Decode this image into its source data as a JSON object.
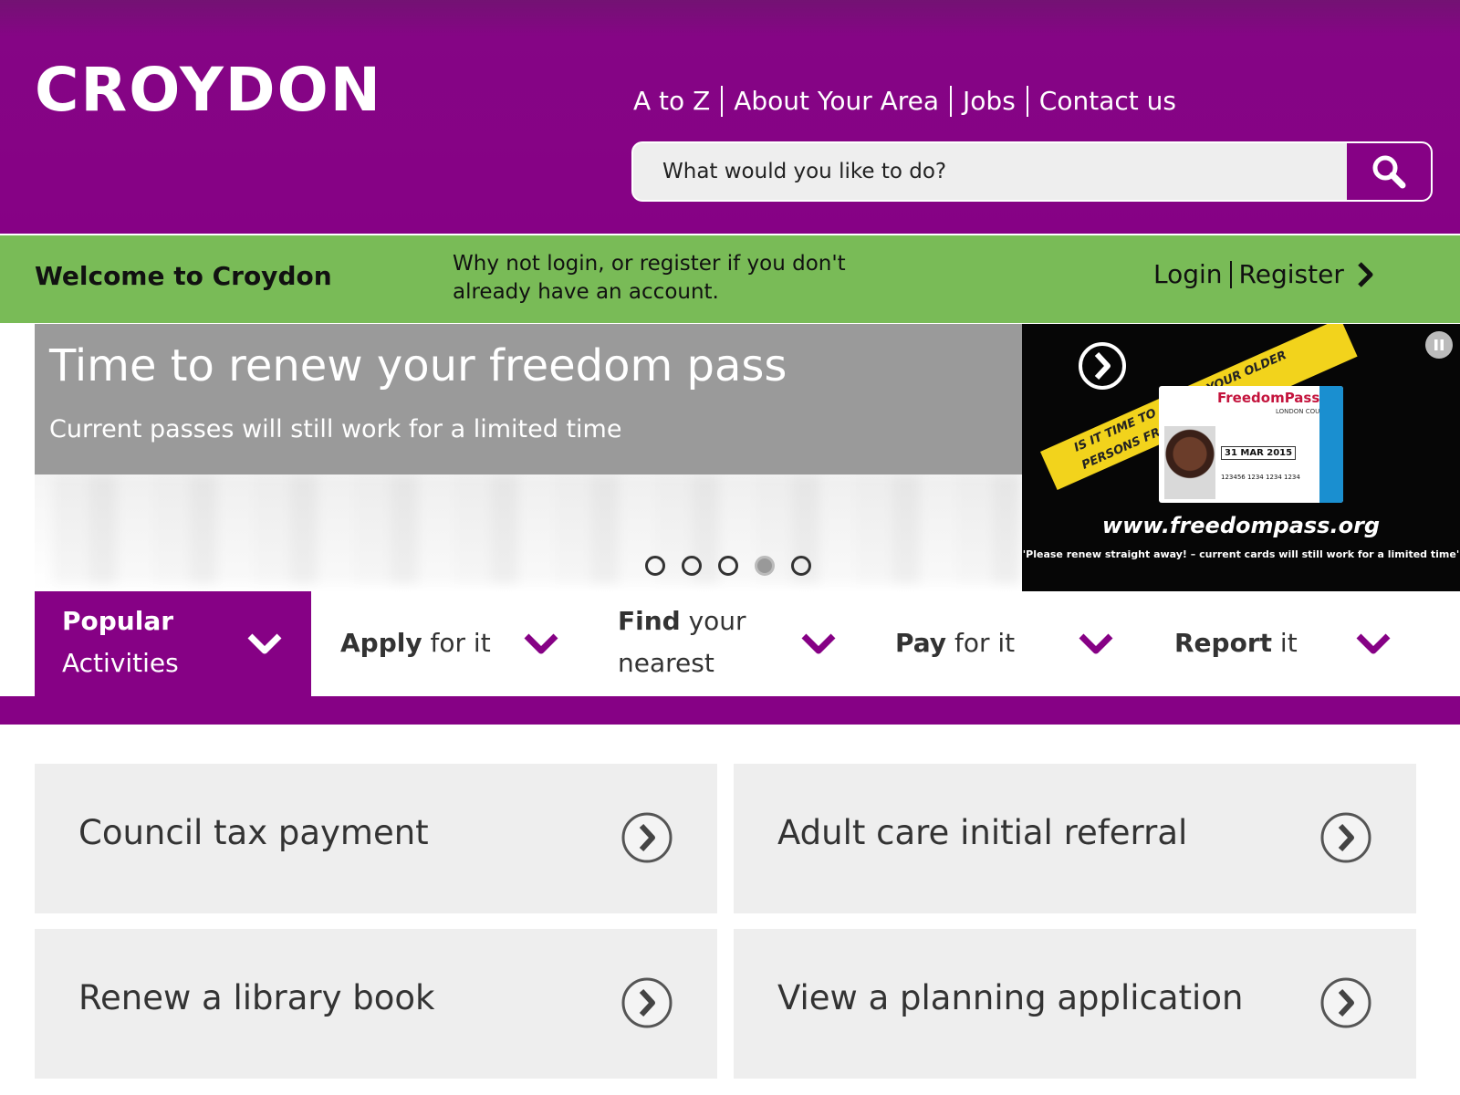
{
  "header": {
    "logo": "CROYDON",
    "nav": [
      "A to Z",
      "About Your Area",
      "Jobs",
      "Contact us"
    ],
    "search_placeholder": "What would you like to do?"
  },
  "welcome": {
    "title": "Welcome to Croydon",
    "message": "Why not login, or register if you don't already have an account.",
    "login_label": "Login",
    "register_label": "Register"
  },
  "carousel": {
    "title": "Time to renew your freedom pass",
    "subtitle": "Current passes will still work for a limited time",
    "slide_count": 5,
    "active_slide": 4,
    "ad": {
      "banner": "IS IT TIME TO RENEW YOUR OLDER PERSONS FREEDOM PASS?",
      "card_brand": "FreedomPass",
      "card_sub": "LONDON COUNCILS",
      "card_date": "31 MAR 2015",
      "card_number": "123456 1234 1234 1234",
      "url": "www.freedompass.org",
      "note": "'Please renew straight away! – current cards will still work for a limited time'"
    }
  },
  "tabs": [
    {
      "bold": "Popular",
      "rest": "Activities",
      "active": true
    },
    {
      "bold": "Apply",
      "rest": " for it",
      "active": false
    },
    {
      "bold": "Find",
      "rest": " your nearest",
      "active": false
    },
    {
      "bold": "Pay",
      "rest": " for it",
      "active": false
    },
    {
      "bold": "Report",
      "rest": " it",
      "active": false
    }
  ],
  "activities": [
    "Council tax payment",
    "Adult care initial referral",
    "Renew a library book",
    "View a planning application"
  ],
  "colors": {
    "brand_purple": "#860185",
    "welcome_green": "#79bb57",
    "card_grey": "#eeeeee"
  }
}
